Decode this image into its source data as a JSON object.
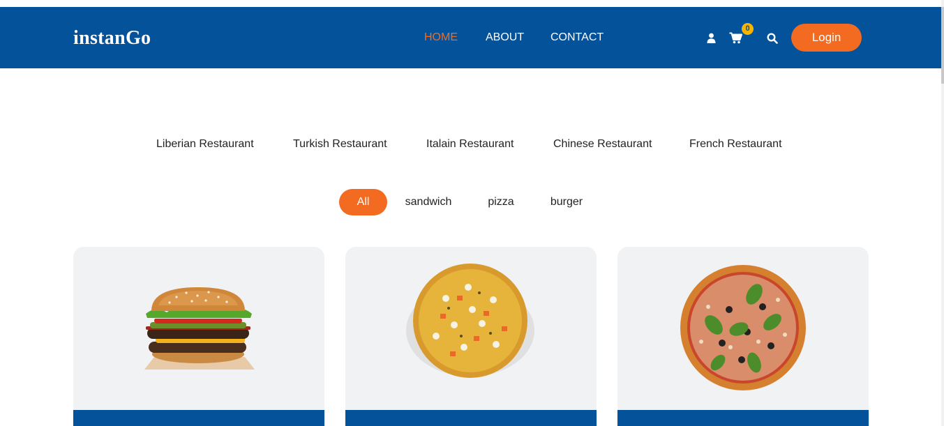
{
  "brand": {
    "name": "instanGo"
  },
  "nav": {
    "items": [
      {
        "label": "HOME",
        "active": true
      },
      {
        "label": "ABOUT",
        "active": false
      },
      {
        "label": "CONTACT",
        "active": false
      }
    ]
  },
  "header_actions": {
    "user_icon": "user-icon",
    "cart_icon": "cart-icon",
    "cart_count": "0",
    "search_icon": "search-icon",
    "login_label": "Login"
  },
  "restaurants": [
    "Liberian Restaurant",
    "Turkish Restaurant",
    "Italain Restaurant",
    "Chinese Restaurant",
    "French Restaurant"
  ],
  "filters": [
    {
      "label": "All",
      "active": true
    },
    {
      "label": "sandwich",
      "active": false
    },
    {
      "label": "pizza",
      "active": false
    },
    {
      "label": "burger",
      "active": false
    }
  ],
  "cards": [
    {
      "image": "burger-image"
    },
    {
      "image": "pizza-image"
    },
    {
      "image": "pizza-image"
    }
  ],
  "colors": {
    "header_bg": "#04529a",
    "accent": "#f26b21",
    "badge": "#f7b500",
    "card_bg": "#f1f2f4"
  }
}
